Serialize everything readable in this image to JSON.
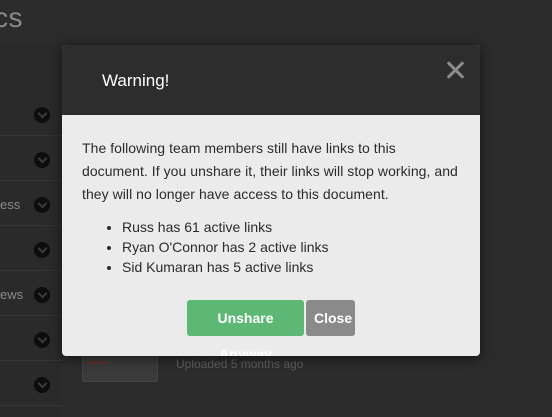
{
  "background": {
    "title_fragment": "cs",
    "sidebar_snippets": [
      "",
      "",
      "ess",
      "",
      "ews",
      "",
      ""
    ],
    "uploaded_text": "Uploaded 5 months ago"
  },
  "modal": {
    "title": "Warning!",
    "close_icon": "close-icon",
    "message": "The following team members still have links to this document. If you unshare it, their links will stop working, and they will no longer have access to this document.",
    "members": [
      "Russ has 61 active links",
      "Ryan O'Connor has 2 active links",
      "Sid Kumaran has 5 active links"
    ],
    "buttons": {
      "unshare_label": "Unshare Anyway",
      "close_label": "Close"
    }
  },
  "colors": {
    "header_bg": "#2d2d2d",
    "body_bg": "#ebebeb",
    "primary_green": "#5cb874",
    "secondary_gray": "#8a8a8a"
  }
}
